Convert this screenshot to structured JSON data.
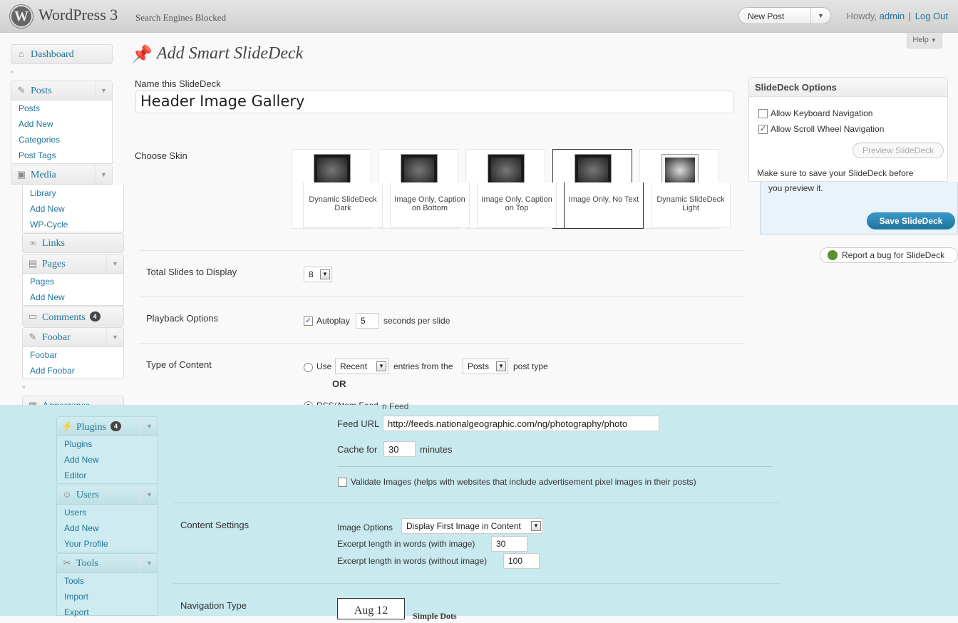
{
  "header": {
    "site_title": "WordPress 3",
    "site_subtitle": "Search Engines Blocked",
    "favorite_action": "New Post",
    "howdy": "Howdy,",
    "user": "admin",
    "separator": "|",
    "logout": "Log Out"
  },
  "help": "Help",
  "menu": {
    "dashboard": "Dashboard",
    "posts": {
      "label": "Posts",
      "items": [
        "Posts",
        "Add New",
        "Categories",
        "Post Tags"
      ]
    },
    "media": {
      "label": "Media",
      "items": [
        "Library",
        "Add New",
        "WP-Cycle"
      ]
    },
    "links": "Links",
    "pages": {
      "label": "Pages",
      "items": [
        "Pages",
        "Add New"
      ]
    },
    "comments": {
      "label": "Comments",
      "count": "4"
    },
    "foobar": {
      "label": "Foobar",
      "items": [
        "Foobar",
        "Add Foobar"
      ]
    },
    "appearance": "Appearance",
    "plugins": {
      "label": "Plugins",
      "count": "4",
      "items": [
        "Plugins",
        "Add New",
        "Editor"
      ]
    },
    "users": {
      "label": "Users",
      "items": [
        "Users",
        "Add New",
        "Your Profile"
      ]
    },
    "tools": {
      "label": "Tools",
      "items": [
        "Tools",
        "Import",
        "Export"
      ]
    }
  },
  "page": {
    "title": "Add Smart SlideDeck",
    "name_label": "Name this SlideDeck",
    "name_value": "Header Image Gallery",
    "skin_label": "Choose Skin",
    "skins": [
      {
        "name": "Dynamic SlideDeck Dark",
        "selected": false
      },
      {
        "name": "Image Only, Caption on Bottom",
        "selected": false
      },
      {
        "name": "Image Only, Caption on Top",
        "selected": false
      },
      {
        "name": "Image Only, No Text",
        "selected": true
      },
      {
        "name": "Dynamic SlideDeck Light",
        "selected": false
      }
    ],
    "total_slides_label": "Total Slides to Display",
    "total_slides_value": "8",
    "playback_label": "Playback Options",
    "autoplay_label": "Autoplay",
    "autoplay_checked": true,
    "autoplay_seconds": "5",
    "seconds_per_slide": "seconds per slide",
    "content_type_label": "Type of Content",
    "use_label": "Use",
    "recent_value": "Recent",
    "entries_from": "entries from the",
    "post_type_value": "Posts",
    "post_type_label": "post type",
    "or_label": "OR",
    "rss_label": "RSS/Atom Feed",
    "rss_ghost": "n Feed",
    "feed_url_label": "Feed URL",
    "feed_url_value": "http://feeds.nationalgeographic.com/ng/photography/photo",
    "cache_label": "Cache for",
    "cache_value": "30",
    "minutes": "minutes",
    "validate_label": "Validate Images (helps with websites that include advertisement pixel images in their posts)",
    "content_settings_label": "Content Settings",
    "image_options_label": "Image Options",
    "image_options_value": "Display First Image in Content",
    "excerpt_with_label": "Excerpt length in words (with image)",
    "excerpt_with_value": "30",
    "excerpt_without_label": "Excerpt length in words (without image)",
    "excerpt_without_value": "100",
    "nav_type_label": "Navigation Type",
    "nav_date_sample": "Aug 12",
    "nav_simple_dots": "Simple Dots"
  },
  "sidebar": {
    "title": "SlideDeck Options",
    "keyboard_nav": "Allow Keyboard Navigation",
    "keyboard_checked": false,
    "scroll_nav": "Allow Scroll Wheel Navigation",
    "scroll_checked": true,
    "preview_button": "Preview SlideDeck",
    "save_note": "Make sure to save your SlideDeck before you preview it.",
    "save_button": "Save SlideDeck",
    "bug_button": "Report a bug for SlideDeck"
  }
}
